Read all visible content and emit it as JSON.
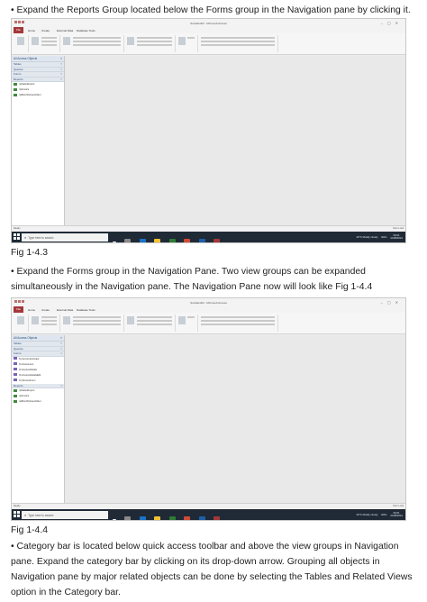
{
  "paragraphs": {
    "p1": "• Expand the Reports Group located below the Forms group in the Navigation pane by clicking it.",
    "p2": "• Expand the Forms group in the Navigation Pane. Two view groups can be expanded simultaneously in the Navigation pane. The Navigation Pane now will look like Fig 1-4.4",
    "p3": "• Category bar is located below quick access toolbar and above the view groups in Navigation pane. Expand the category bar by clicking on its drop-down arrow. Grouping all objects in Navigation pane by major related objects can be done by selecting the Tables and Related Views option in the Category bar."
  },
  "captions": {
    "fig1": "Fig 1-4.3",
    "fig2": "Fig 1-4.4"
  },
  "screenshots": [
    {
      "window_title": "Scottland01 : Microsoft Access",
      "tabs": [
        "File",
        "Home",
        "Create",
        "External Data",
        "Database Tools"
      ],
      "nav_header": "All Access Objects",
      "groups": [
        {
          "label": "Tables",
          "items": []
        },
        {
          "label": "Queries",
          "items": []
        },
        {
          "label": "Forms",
          "items": []
        },
        {
          "label": "Reports",
          "items": [
            "rptSalesReport",
            "rptInvoice",
            "rptMonthlyFeesClient"
          ]
        }
      ],
      "status_left": "Ready",
      "status_right": "Num Lock",
      "taskbar": {
        "search_placeholder": "Type here to search",
        "weather": "29°C Mostly cloudy",
        "language": "ENG",
        "time": "09:01",
        "date": "11/08/2021"
      }
    },
    {
      "window_title": "Scottland01 : Microsoft Access",
      "tabs": [
        "File",
        "Home",
        "Create",
        "External Data",
        "Database Tools"
      ],
      "nav_header": "All Access Objects",
      "groups": [
        {
          "label": "Tables",
          "items": []
        },
        {
          "label": "Queries",
          "items": []
        },
        {
          "label": "Forms",
          "items": [
            "frmAccountActivate",
            "frmCustomers",
            "frmInvoiceDetails",
            "frmInvoiceDetailsEdit",
            "frmServiceForm"
          ]
        },
        {
          "label": "Reports",
          "items": [
            "rptSalesReport",
            "rptInvoice",
            "rptMonthlyFeesClient"
          ]
        }
      ],
      "status_left": "Ready",
      "status_right": "Num Lock",
      "taskbar": {
        "search_placeholder": "Type here to search",
        "weather": "29°C Mostly cloudy",
        "language": "ENG",
        "time": "09:01",
        "date": "11/08/2021"
      }
    }
  ],
  "colors": {
    "access_red": "#a4373a",
    "taskbar": "#1f2a36",
    "nav_blue": "#2b4f7a"
  }
}
